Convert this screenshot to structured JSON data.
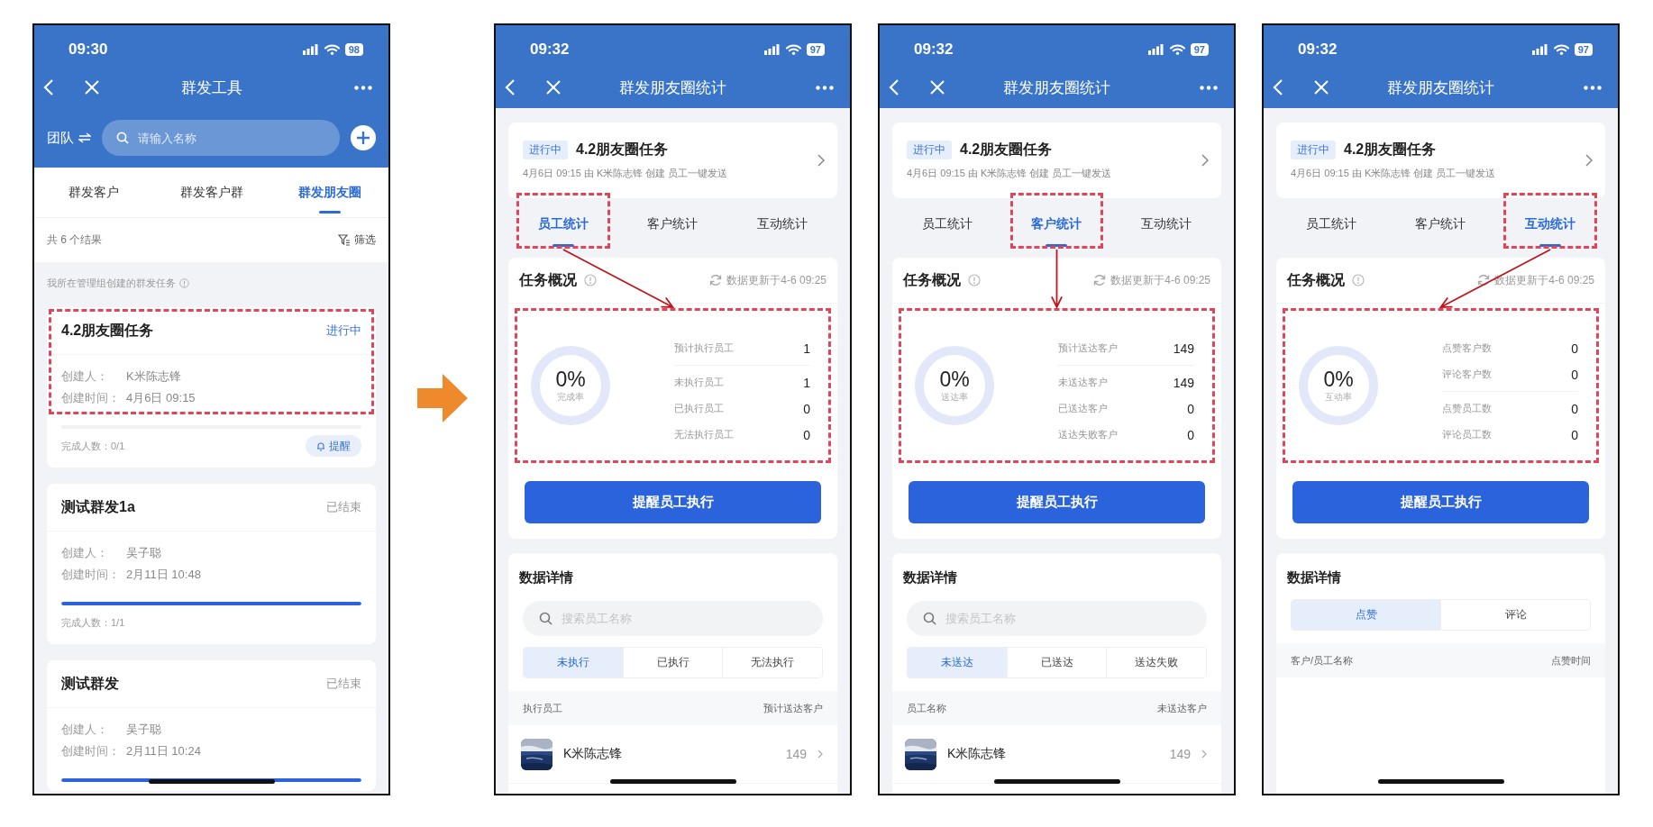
{
  "screens": [
    {
      "kind": "task_list",
      "time": "09:30",
      "battery": "98",
      "title": "群发工具",
      "team": "团队",
      "search": {
        "placeholder": "请输入名称"
      },
      "tabs": [
        {
          "label": "群发客户",
          "selected": false
        },
        {
          "label": "群发客户群",
          "selected": false
        },
        {
          "label": "群发朋友圈",
          "selected": true
        }
      ],
      "result_count": "共 6 个结果",
      "filter": "筛选",
      "section_label": "我所在管理组创建的群发任务",
      "tasks": [
        {
          "title": "4.2朋友圈任务",
          "status": "进行中",
          "active": true,
          "highlighted": true,
          "creator_label": "创建人：",
          "creator": "K米陈志锋",
          "time_label": "创建时间：",
          "time": "4月6日 09:15",
          "level": 0,
          "completion": "完成人数：0/1",
          "remind": "提醒"
        },
        {
          "title": "测试群发1a",
          "status": "已结束",
          "active": false,
          "highlighted": false,
          "creator_label": "创建人：",
          "creator": "吴子聪",
          "time_label": "创建时间：",
          "time": "2月11日 10:48",
          "level": 1,
          "completion": "完成人数：1/1"
        },
        {
          "title": "测试群发",
          "status": "已结束",
          "active": false,
          "highlighted": false,
          "creator_label": "创建人：",
          "creator": "吴子聪",
          "time_label": "创建时间：",
          "time": "2月11日 10:24",
          "level": 1
        }
      ]
    },
    {
      "kind": "stats",
      "time": "09:32",
      "battery": "97",
      "title": "群发朋友圈统计",
      "annotated": true,
      "task": {
        "status": "进行中",
        "title": "4.2朋友圈任务",
        "meta": "4月6日 09:15 由 K米陈志锋 创建 员工一键发送"
      },
      "tabs": [
        {
          "label": "员工统计",
          "selected": true
        },
        {
          "label": "客户统计",
          "selected": false
        },
        {
          "label": "互动统计",
          "selected": false
        }
      ],
      "overview": {
        "title": "任务概况",
        "updated": "数据更新于4-6 09:25",
        "rate": "0%",
        "rate_label": "完成率",
        "stat_groups": [
          [
            {
              "label": "预计执行员工",
              "value": "1"
            }
          ],
          [
            {
              "label": "未执行员工",
              "value": "1"
            },
            {
              "label": "已执行员工",
              "value": "0"
            },
            {
              "label": "无法执行员工",
              "value": "0"
            }
          ]
        ]
      },
      "button": "提醒员工执行",
      "details": {
        "title": "数据详情",
        "search": {
          "placeholder": "搜索员工名称"
        },
        "segments": [
          {
            "label": "未执行",
            "selected": true
          },
          {
            "label": "已执行",
            "selected": false
          },
          {
            "label": "无法执行",
            "selected": false
          }
        ],
        "columns": [
          "执行员工",
          "预计送达客户"
        ],
        "rows": [
          {
            "name": "K米陈志锋",
            "value": "149"
          }
        ]
      }
    },
    {
      "kind": "stats",
      "time": "09:32",
      "battery": "97",
      "title": "群发朋友圈统计",
      "annotated": true,
      "task": {
        "status": "进行中",
        "title": "4.2朋友圈任务",
        "meta": "4月6日 09:15 由 K米陈志锋 创建 员工一键发送"
      },
      "tabs": [
        {
          "label": "员工统计",
          "selected": false
        },
        {
          "label": "客户统计",
          "selected": true
        },
        {
          "label": "互动统计",
          "selected": false
        }
      ],
      "overview": {
        "title": "任务概况",
        "updated": "数据更新于4-6 09:25",
        "rate": "0%",
        "rate_label": "送达率",
        "stat_groups": [
          [
            {
              "label": "预计送达客户",
              "value": "149"
            }
          ],
          [
            {
              "label": "未送达客户",
              "value": "149"
            },
            {
              "label": "已送达客户",
              "value": "0"
            },
            {
              "label": "送达失败客户",
              "value": "0"
            }
          ]
        ]
      },
      "button": "提醒员工执行",
      "details": {
        "title": "数据详情",
        "search": {
          "placeholder": "搜索员工名称"
        },
        "segments": [
          {
            "label": "未送达",
            "selected": true
          },
          {
            "label": "已送达",
            "selected": false
          },
          {
            "label": "送达失败",
            "selected": false
          }
        ],
        "columns": [
          "员工名称",
          "未送达客户"
        ],
        "rows": [
          {
            "name": "K米陈志锋",
            "value": "149"
          }
        ]
      }
    },
    {
      "kind": "stats",
      "time": "09:32",
      "battery": "97",
      "title": "群发朋友圈统计",
      "annotated": true,
      "task": {
        "status": "进行中",
        "title": "4.2朋友圈任务",
        "meta": "4月6日 09:15 由 K米陈志锋 创建 员工一键发送"
      },
      "tabs": [
        {
          "label": "员工统计",
          "selected": false
        },
        {
          "label": "客户统计",
          "selected": false
        },
        {
          "label": "互动统计",
          "selected": true
        }
      ],
      "overview": {
        "title": "任务概况",
        "updated": "数据更新于4-6 09:25",
        "rate": "0%",
        "rate_label": "互动率",
        "stat_groups": [
          [
            {
              "label": "点赞客户数",
              "value": "0"
            },
            {
              "label": "评论客户数",
              "value": "0"
            }
          ],
          [
            {
              "label": "点赞员工数",
              "value": "0"
            },
            {
              "label": "评论员工数",
              "value": "0"
            }
          ]
        ]
      },
      "button": "提醒员工执行",
      "details": {
        "title": "数据详情",
        "segments": [
          {
            "label": "点赞",
            "selected": true
          },
          {
            "label": "评论",
            "selected": false
          }
        ],
        "columns": [
          "客户/员工名称",
          "点赞时间"
        ]
      }
    }
  ]
}
